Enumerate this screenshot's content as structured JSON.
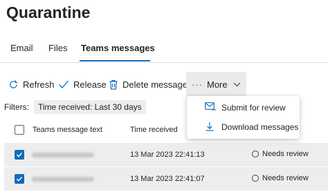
{
  "page": {
    "title": "Quarantine"
  },
  "tabs": [
    {
      "label": "Email"
    },
    {
      "label": "Files"
    },
    {
      "label": "Teams messages"
    }
  ],
  "toolbar": {
    "refresh_label": "Refresh",
    "release_label": "Release",
    "delete_label": "Delete messages",
    "more_label": "More"
  },
  "filters": {
    "label": "Filters:",
    "chip": "Time received: Last 30 days"
  },
  "table": {
    "columns": [
      "Teams message text",
      "Time received"
    ],
    "rows": [
      {
        "time": "13 Mar 2023 22:41:13",
        "status": "Needs review"
      },
      {
        "time": "13 Mar 2023 22:41:07",
        "status": "Needs review"
      }
    ]
  },
  "more_menu": {
    "items": [
      {
        "label": "Submit for review",
        "icon": "submit-mail-icon"
      },
      {
        "label": "Download messages",
        "icon": "download-icon"
      }
    ]
  },
  "colors": {
    "accent": "#0f6cbd",
    "selected_row": "#ededed"
  }
}
